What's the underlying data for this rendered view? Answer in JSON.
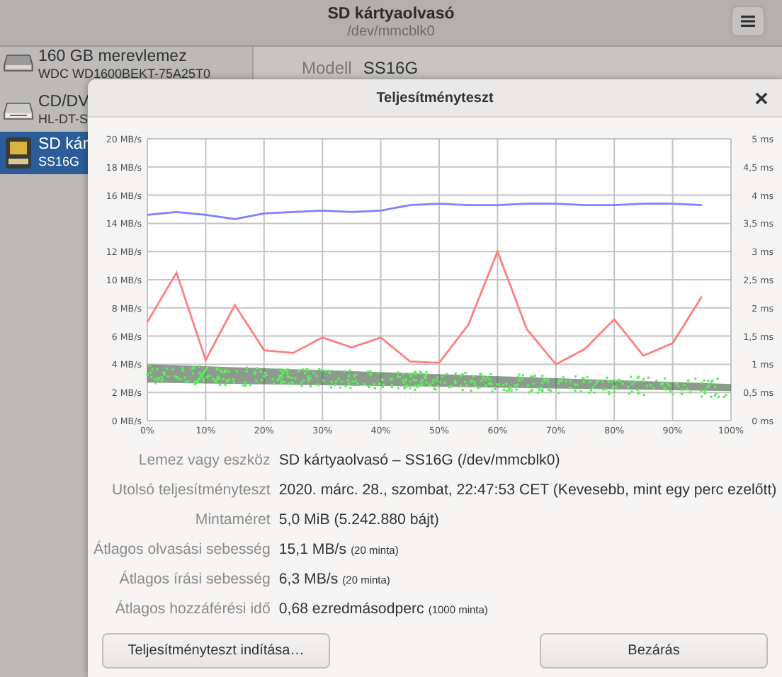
{
  "window": {
    "title": "SD kártyaolvasó",
    "subtitle": "/dev/mmcblk0"
  },
  "sidebar": {
    "items": [
      {
        "kind": "hdd",
        "title": "160 GB merevlemez",
        "subtitle": "WDC WD1600BEKT-75A25T0",
        "selected": false
      },
      {
        "kind": "optical",
        "title": "CD/DV",
        "subtitle": "HL-DT-S",
        "selected": false
      },
      {
        "kind": "sd",
        "title": "SD kár",
        "subtitle": "SS16G",
        "selected": true
      }
    ]
  },
  "details": {
    "label": "Modell",
    "value": "SS16G"
  },
  "dialog": {
    "title": "Teljesítményteszt",
    "chart_data": {
      "type": "line",
      "x": [
        0,
        5,
        10,
        15,
        20,
        25,
        30,
        35,
        40,
        45,
        50,
        55,
        60,
        65,
        70,
        75,
        80,
        85,
        90,
        95
      ],
      "series": [
        {
          "color": "#8080ff",
          "values": [
            14.6,
            14.8,
            14.6,
            14.3,
            14.7,
            14.8,
            14.9,
            14.8,
            14.9,
            15.3,
            15.4,
            15.3,
            15.3,
            15.4,
            15.4,
            15.3,
            15.3,
            15.4,
            15.4,
            15.3
          ]
        },
        {
          "color": "#ff8080",
          "values": [
            7.0,
            10.5,
            4.3,
            8.2,
            5.0,
            4.8,
            5.9,
            5.2,
            5.9,
            4.2,
            4.1,
            6.8,
            12.0,
            6.5,
            4.0,
            5.1,
            7.2,
            4.6,
            5.5,
            8.8
          ]
        }
      ],
      "xlim": [
        0,
        100
      ],
      "ylim": [
        0,
        20
      ],
      "grid": true,
      "xticks": [
        {
          "value": 0,
          "label": "0%"
        },
        {
          "value": 10,
          "label": "10%"
        },
        {
          "value": 20,
          "label": "20%"
        },
        {
          "value": 30,
          "label": "30%"
        },
        {
          "value": 40,
          "label": "40%"
        },
        {
          "value": 50,
          "label": "50%"
        },
        {
          "value": 60,
          "label": "60%"
        },
        {
          "value": 70,
          "label": "70%"
        },
        {
          "value": 80,
          "label": "80%"
        },
        {
          "value": 90,
          "label": "90%"
        },
        {
          "value": 100,
          "label": "100%"
        }
      ],
      "yticks": [
        {
          "value": 0,
          "label": "0 MB/s"
        },
        {
          "value": 2,
          "label": "2 MB/s"
        },
        {
          "value": 4,
          "label": "4 MB/s"
        },
        {
          "value": 6,
          "label": "6 MB/s"
        },
        {
          "value": 8,
          "label": "8 MB/s"
        },
        {
          "value": 10,
          "label": "10 MB/s"
        },
        {
          "value": 12,
          "label": "12 MB/s"
        },
        {
          "value": 14,
          "label": "14 MB/s"
        },
        {
          "value": 16,
          "label": "16 MB/s"
        },
        {
          "value": 18,
          "label": "18 MB/s"
        },
        {
          "value": 20,
          "label": "20 MB/s"
        }
      ]
    },
    "right_axis_labels": [
      "5 ms",
      "4,5 ms",
      "4 ms",
      "3,5 ms",
      "3 ms",
      "2,5 ms",
      "2 ms",
      "1,5 ms",
      "1 ms",
      "0,5 ms",
      "0 ms"
    ],
    "info": [
      {
        "label": "Lemez vagy eszköz",
        "value": "SD kártyaolvasó – SS16G (/dev/mmcblk0)"
      },
      {
        "label": "Utolsó teljesítményteszt",
        "value": "2020. márc. 28., szombat, 22:47:53 CET (Kevesebb, mint egy perc ezelőtt)"
      },
      {
        "label": "Mintaméret",
        "value": "5,0 MiB (5.242.880 bájt)"
      },
      {
        "label": "Átlagos olvasási sebesség",
        "value": "15,1 MB/s",
        "note": "(20 minta)"
      },
      {
        "label": "Átlagos írási sebesség",
        "value": "6,3 MB/s",
        "note": "(20 minta)"
      },
      {
        "label": "Átlagos hozzáférési idő",
        "value": "0,68 ezredmásodperc",
        "note": "(1000 minta)"
      }
    ],
    "buttons": [
      {
        "label": "Teljesítményteszt indítása…"
      },
      {
        "label": "Bezárás"
      }
    ]
  }
}
